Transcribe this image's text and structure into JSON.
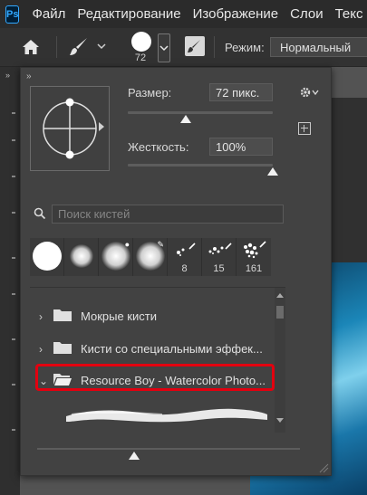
{
  "app": {
    "logo": "Ps"
  },
  "menubar": {
    "items": [
      "Файл",
      "Редактирование",
      "Изображение",
      "Слои",
      "Текс"
    ]
  },
  "options_bar": {
    "brush_size_value": "72",
    "mode_label": "Режим:",
    "mode_value": "Нормальный"
  },
  "brush_panel": {
    "size_label": "Размер:",
    "size_value": "72 пикс.",
    "size_slider_fraction": 0.4,
    "hardness_label": "Жесткость:",
    "hardness_value": "100%",
    "hardness_slider_fraction": 1.0,
    "search_placeholder": "Поиск кистей",
    "tips": [
      {
        "kind": "hard-round",
        "count": ""
      },
      {
        "kind": "soft-round",
        "count": ""
      },
      {
        "kind": "soft-round-pressure-opacity",
        "count": ""
      },
      {
        "kind": "soft-round-pressure-size",
        "count": ""
      },
      {
        "kind": "scatter-small",
        "count": "8"
      },
      {
        "kind": "scatter-medium",
        "count": "15"
      },
      {
        "kind": "scatter-large",
        "count": "161"
      }
    ],
    "folders": [
      {
        "name": "Мокрые кисти",
        "expanded": false
      },
      {
        "name": "Кисти со специальными эффек...",
        "expanded": false
      },
      {
        "name": "Resource Boy - Watercolor Photo...",
        "expanded": true
      }
    ],
    "highlight_color": "#e3000f",
    "preview_slider_fraction": 0.37
  }
}
